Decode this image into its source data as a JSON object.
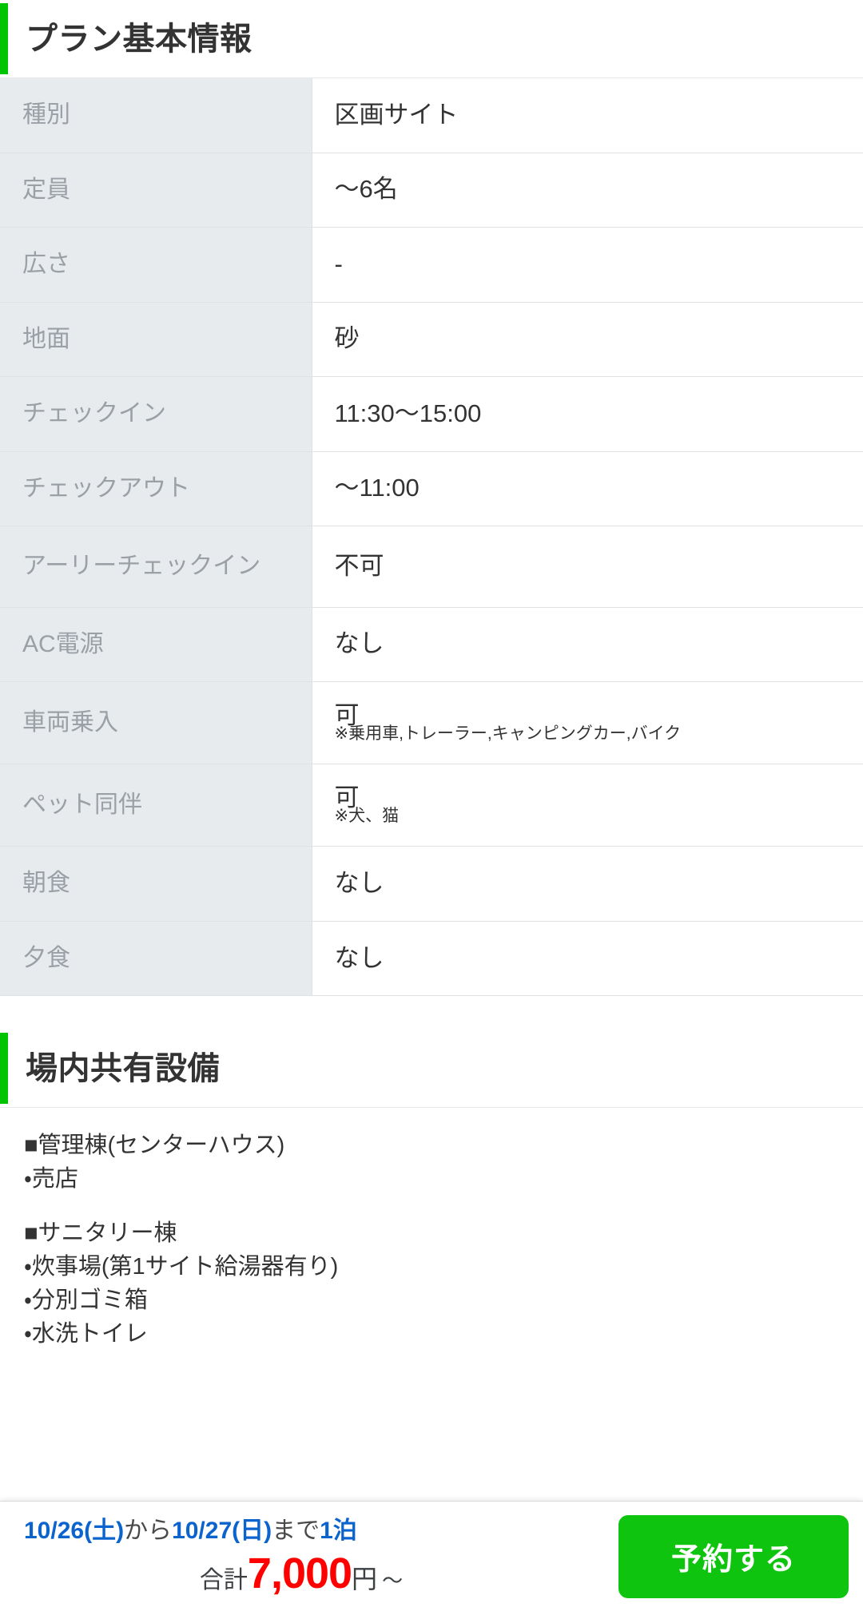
{
  "plan_section": {
    "heading": "プラン基本情報",
    "accent_color": "#00c400",
    "rows": [
      {
        "label": "種別",
        "value": "区画サイト",
        "note": ""
      },
      {
        "label": "定員",
        "value": "〜6名",
        "note": ""
      },
      {
        "label": "広さ",
        "value": "-",
        "note": ""
      },
      {
        "label": "地面",
        "value": "砂",
        "note": ""
      },
      {
        "label": "チェックイン",
        "value": "11:30〜15:00",
        "note": ""
      },
      {
        "label": "チェックアウト",
        "value": "〜11:00",
        "note": ""
      },
      {
        "label": "アーリーチェックイン",
        "value": "不可",
        "note": ""
      },
      {
        "label": "AC電源",
        "value": "なし",
        "note": ""
      },
      {
        "label": "車両乗入",
        "value": "可",
        "note": "※乗用車,トレーラー,キャンピングカー,バイク"
      },
      {
        "label": "ペット同伴",
        "value": "可",
        "note": "※犬、猫"
      },
      {
        "label": "朝食",
        "value": "なし",
        "note": ""
      },
      {
        "label": "夕食",
        "value": "なし",
        "note": ""
      }
    ]
  },
  "facility_section": {
    "heading": "場内共有設備",
    "groups": [
      {
        "title": "■管理棟(センターハウス)",
        "items": [
          "・売店"
        ]
      },
      {
        "title": "■サニタリー棟",
        "items": [
          "・炊事場(第1サイト給湯器有り)",
          "・分別ゴミ箱",
          "・水洗トイレ"
        ]
      }
    ]
  },
  "booking_bar": {
    "date_from": "10/26(土)",
    "date_from_suffix": "から",
    "date_to": "10/27(日)",
    "date_to_suffix": "まで",
    "nights": "1泊",
    "total_label": "合計",
    "total_amount": "7,000",
    "currency": "円",
    "approx": "〜",
    "reserve_label": "予約する",
    "button_color": "#0fc40f",
    "date_color": "#0b63ce",
    "price_color": "#ff0000"
  }
}
